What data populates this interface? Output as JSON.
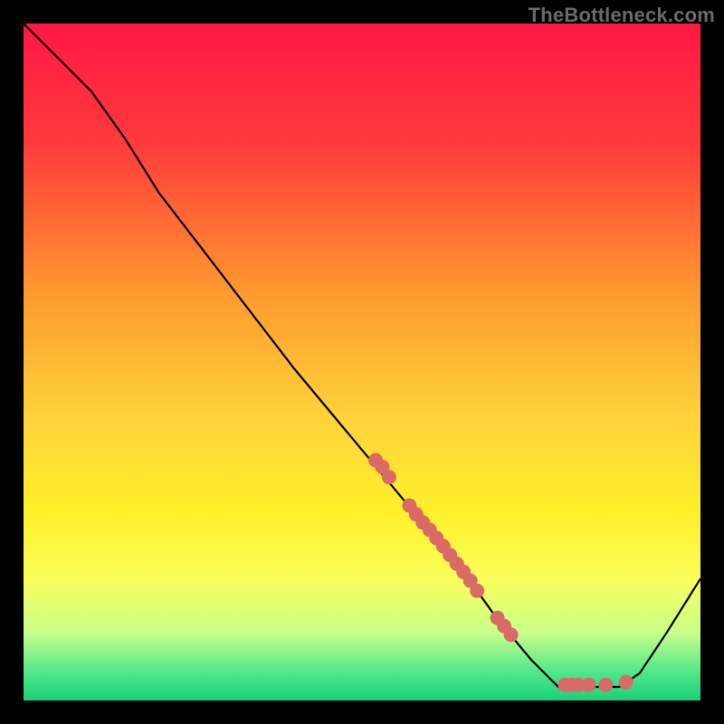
{
  "watermark": "TheBottleneck.com",
  "chart_data": {
    "type": "line",
    "title": "",
    "xlabel": "",
    "ylabel": "",
    "xlim": [
      0,
      100
    ],
    "ylim": [
      0,
      100
    ],
    "grid": false,
    "curve_points": [
      {
        "x": 0,
        "y": 100
      },
      {
        "x": 5,
        "y": 95
      },
      {
        "x": 10,
        "y": 90
      },
      {
        "x": 15,
        "y": 83
      },
      {
        "x": 20,
        "y": 75
      },
      {
        "x": 30,
        "y": 62
      },
      {
        "x": 40,
        "y": 49
      },
      {
        "x": 50,
        "y": 37
      },
      {
        "x": 55,
        "y": 31
      },
      {
        "x": 60,
        "y": 25
      },
      {
        "x": 65,
        "y": 19
      },
      {
        "x": 70,
        "y": 12
      },
      {
        "x": 75,
        "y": 6
      },
      {
        "x": 79,
        "y": 2
      },
      {
        "x": 82,
        "y": 2
      },
      {
        "x": 88,
        "y": 2
      },
      {
        "x": 91,
        "y": 4
      },
      {
        "x": 95,
        "y": 10
      },
      {
        "x": 100,
        "y": 18
      }
    ],
    "scatter_points": [
      {
        "x": 52,
        "y": 35.5
      },
      {
        "x": 53,
        "y": 34.5
      },
      {
        "x": 54,
        "y": 33
      },
      {
        "x": 57,
        "y": 28.8
      },
      {
        "x": 58,
        "y": 27.5
      },
      {
        "x": 59,
        "y": 26.3
      },
      {
        "x": 60,
        "y": 25.2
      },
      {
        "x": 61,
        "y": 24
      },
      {
        "x": 62,
        "y": 22.8
      },
      {
        "x": 63,
        "y": 21.5
      },
      {
        "x": 64,
        "y": 20.2
      },
      {
        "x": 65,
        "y": 19
      },
      {
        "x": 66,
        "y": 17.7
      },
      {
        "x": 67,
        "y": 16.2
      },
      {
        "x": 70,
        "y": 12.2
      },
      {
        "x": 71,
        "y": 11
      },
      {
        "x": 72,
        "y": 9.7
      },
      {
        "x": 80,
        "y": 2.3
      },
      {
        "x": 81,
        "y": 2.3
      },
      {
        "x": 82,
        "y": 2.3
      },
      {
        "x": 83.5,
        "y": 2.3
      },
      {
        "x": 86,
        "y": 2.3
      },
      {
        "x": 89,
        "y": 2.7
      }
    ],
    "gradient_stops": [
      {
        "pct": 0,
        "color": "#ff1744"
      },
      {
        "pct": 18,
        "color": "#ff3b3b"
      },
      {
        "pct": 40,
        "color": "#ff9a2e"
      },
      {
        "pct": 58,
        "color": "#ffd23a"
      },
      {
        "pct": 72,
        "color": "#fff02a"
      },
      {
        "pct": 82,
        "color": "#fbff5a"
      },
      {
        "pct": 90,
        "color": "#c8ff8a"
      },
      {
        "pct": 96,
        "color": "#4de68a"
      },
      {
        "pct": 100,
        "color": "#19d07a"
      }
    ],
    "curve_color": "#000000",
    "point_color": "#d96a66",
    "point_radius": 8
  }
}
